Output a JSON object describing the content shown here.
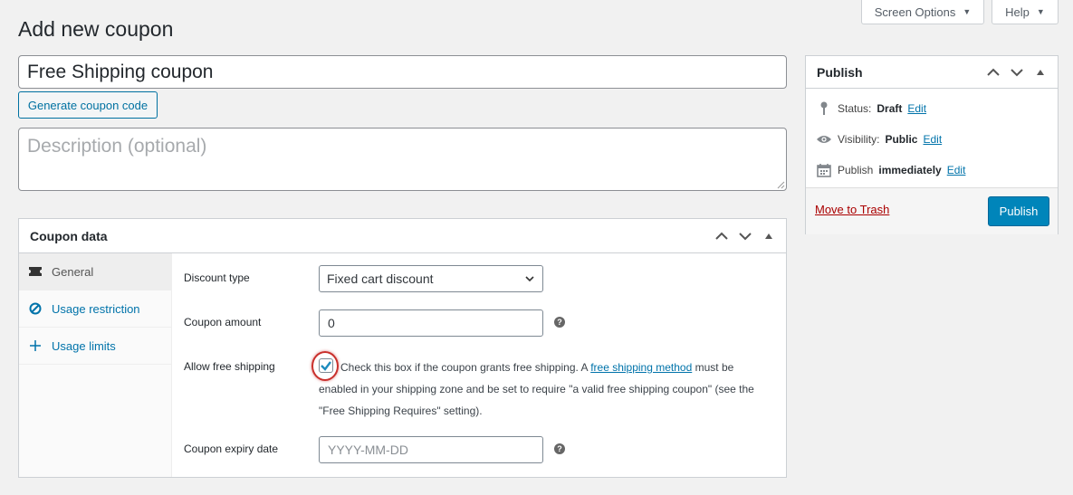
{
  "top_buttons": {
    "screen_options": "Screen Options",
    "help": "Help"
  },
  "page_title": "Add new coupon",
  "coupon_code": "Free Shipping coupon",
  "generate_button": "Generate coupon code",
  "description_placeholder": "Description (optional)",
  "coupon_data": {
    "title": "Coupon data",
    "tabs": [
      {
        "label": "General",
        "icon": "ticket-icon",
        "active": true
      },
      {
        "label": "Usage restriction",
        "icon": "block-icon",
        "active": false
      },
      {
        "label": "Usage limits",
        "icon": "crosshair-icon",
        "active": false
      }
    ],
    "fields": {
      "discount_type_label": "Discount type",
      "discount_type_value": "Fixed cart discount",
      "coupon_amount_label": "Coupon amount",
      "coupon_amount_value": "0",
      "free_shipping_label": "Allow free shipping",
      "free_shipping_checked": true,
      "free_shipping_text_1": "Check this box if the coupon grants free shipping. A",
      "free_shipping_link": "free shipping method",
      "free_shipping_text_2": "must be enabled in your shipping zone and be set to require \"a valid free shipping coupon\" (see the \"Free Shipping Requires\" setting).",
      "expiry_label": "Coupon expiry date",
      "expiry_placeholder": "YYYY-MM-DD"
    }
  },
  "publish": {
    "title": "Publish",
    "status_label": "Status:",
    "status_value": "Draft",
    "visibility_label": "Visibility:",
    "visibility_value": "Public",
    "publish_label": "Publish",
    "publish_value": "immediately",
    "edit": "Edit",
    "trash": "Move to Trash",
    "button": "Publish"
  },
  "colors": {
    "accent": "#0073aa",
    "primary_button": "#0085ba",
    "trash": "#aa0000",
    "highlight_ring": "#c9302c"
  }
}
